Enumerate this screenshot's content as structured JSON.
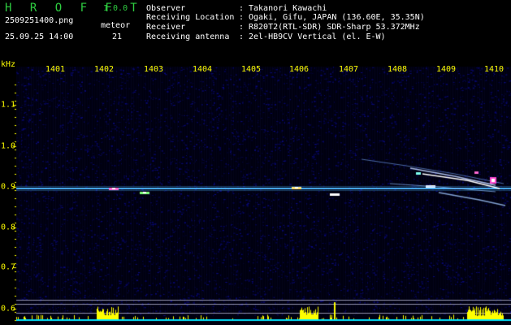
{
  "header": {
    "app_title": "H R O F F T",
    "version": "1.0.0",
    "file_name": "2509251400.png",
    "timestamp": "25.09.25 14:00",
    "meteor_label": "meteor",
    "meteor_count": "21"
  },
  "observation": {
    "rows": [
      {
        "label": "Observer",
        "value": "Takanori Kawachi"
      },
      {
        "label": "Receiving Location",
        "value": "Ogaki, Gifu, JAPAN (136.60E, 35.35N)"
      },
      {
        "label": "Receiver",
        "value": "R820T2(RTL-SDR) SDR-Sharp 53.372MHz"
      },
      {
        "label": "Receiving antenna",
        "value": "2el-HB9CV Vertical (el. E-W)"
      }
    ],
    "separator": ":"
  },
  "axis": {
    "unit": "kHz",
    "x_ticks": [
      "1401",
      "1402",
      "1403",
      "1404",
      "1405",
      "1406",
      "1407",
      "1408",
      "1409",
      "1410"
    ],
    "y_ticks": [
      "1.1",
      "1.0",
      "0.9",
      "0.8",
      "0.7",
      "0.6"
    ]
  },
  "colors": {
    "background": "#000000",
    "noise": "#0a0a6e",
    "carrier": "#4db8ff",
    "echo": "#ffffff",
    "title": "#2ecc40",
    "axis_text": "#ffff00",
    "power_bars": "#ffff00",
    "baseline": "#00e5ff"
  }
}
